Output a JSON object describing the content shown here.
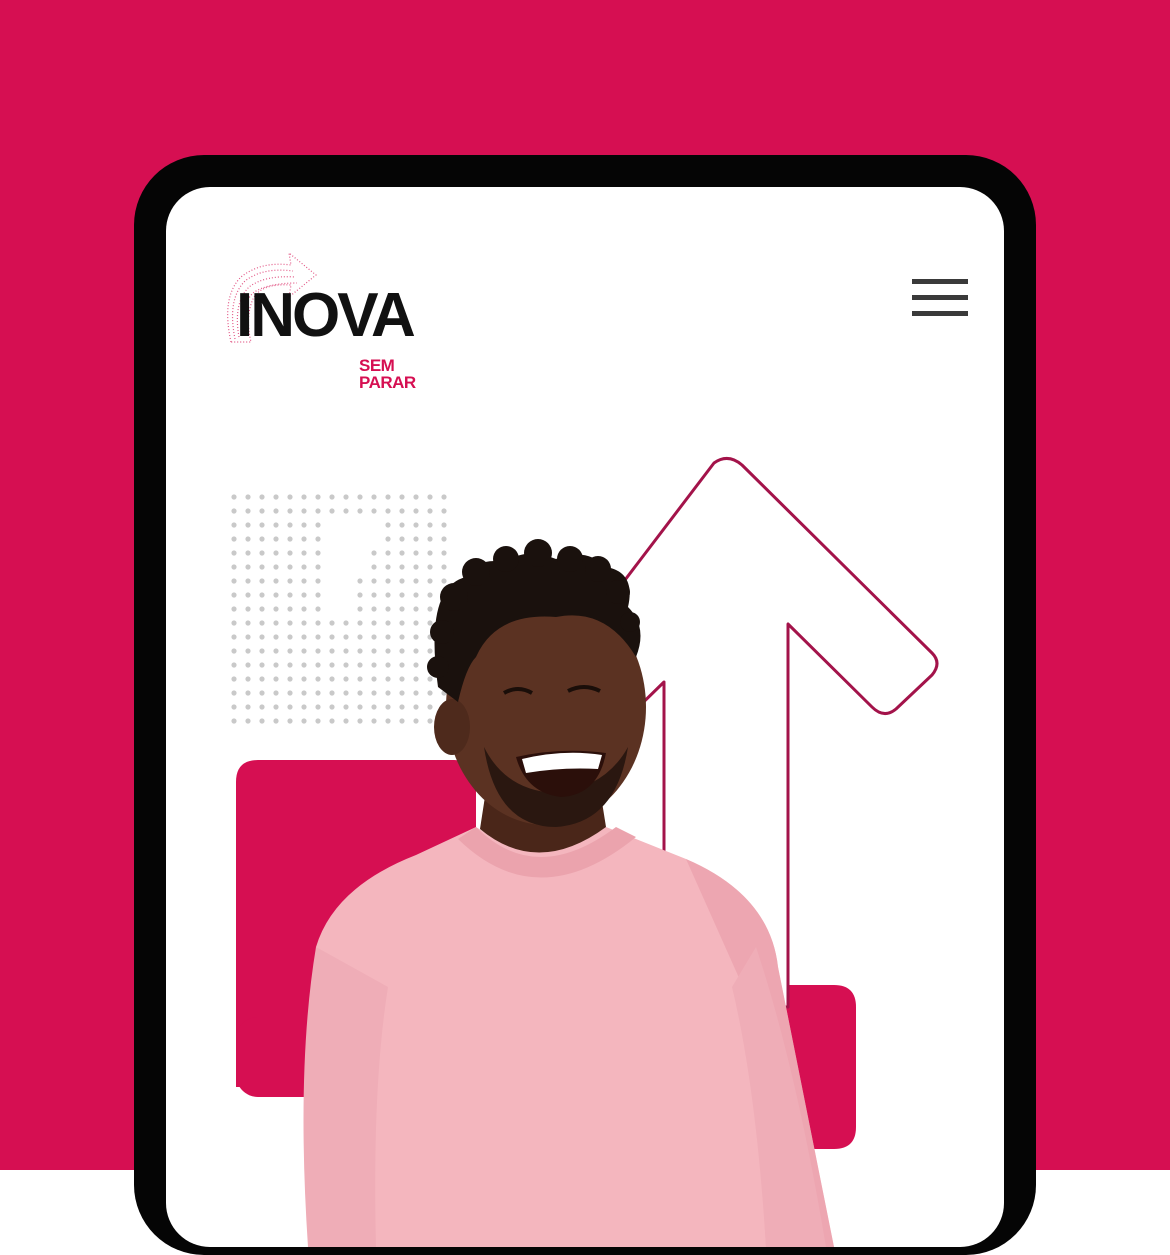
{
  "colors": {
    "brand": "#D60F52",
    "frame": "#050505",
    "screen": "#FFFFFF",
    "arrow_stroke": "#A3134A",
    "sweater": "#F4B6BE",
    "skin": "#5B3222",
    "hair": "#1A110D",
    "dots": "#C9C9C9"
  },
  "logo": {
    "word": "INOVA",
    "tagline": "SEM PARAR",
    "icon": "dotted-arrow-icon"
  },
  "header": {
    "menu_icon": "hamburger-menu-icon"
  },
  "hero": {
    "arrow_icon": "up-arrow-outline-icon",
    "photo": "smiling-man-pink-sweater",
    "pattern": "dotted-arrow-pattern"
  }
}
